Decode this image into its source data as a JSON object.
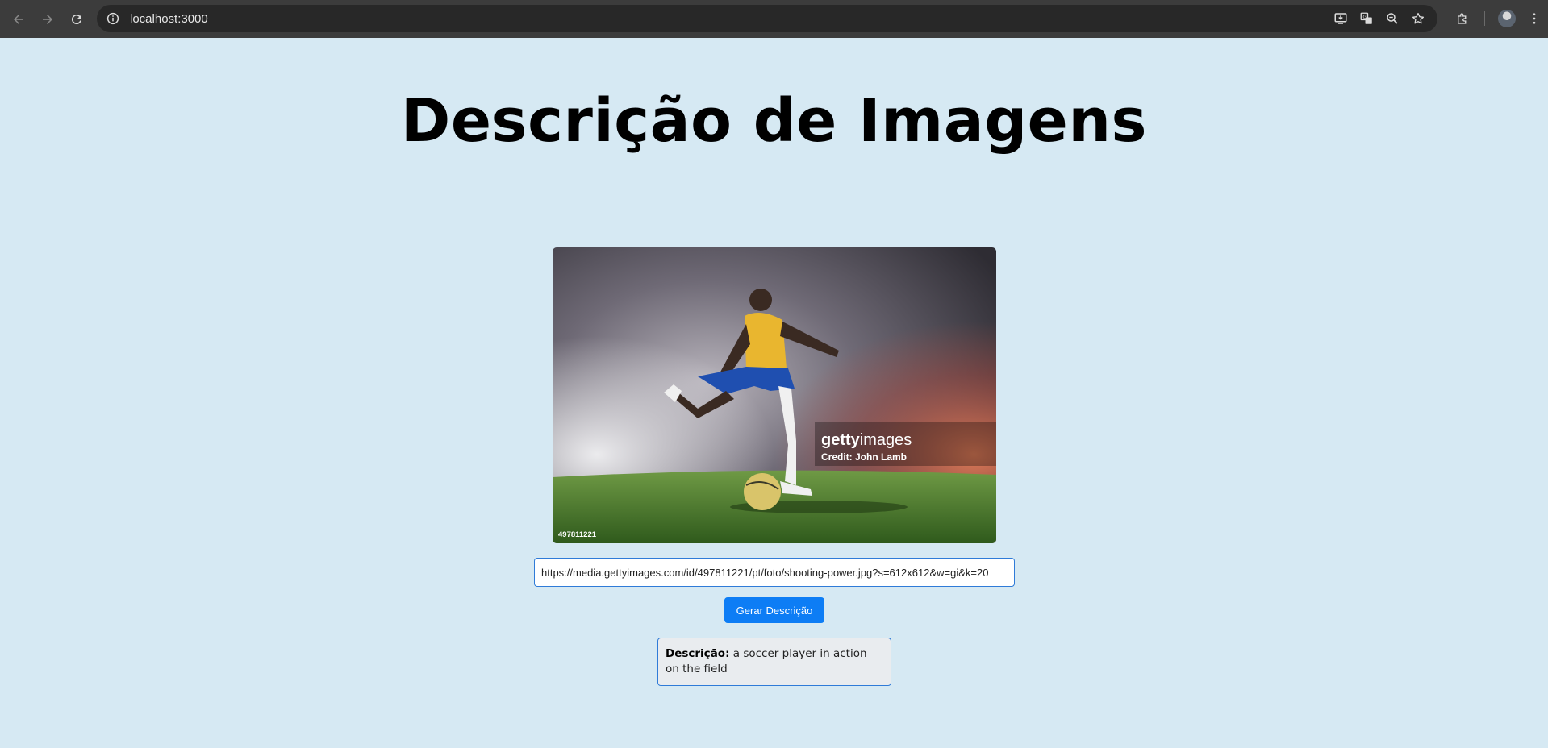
{
  "browser": {
    "url": "localhost:3000",
    "icons": [
      "back-icon",
      "forward-icon",
      "reload-icon",
      "site-info-icon",
      "install-app-icon",
      "translate-icon",
      "zoom-icon",
      "bookmark-star-icon",
      "extensions-icon",
      "profile-avatar",
      "menu-icon"
    ]
  },
  "page": {
    "title": "Descrição de Imagens"
  },
  "image": {
    "watermark_brand_bold": "getty",
    "watermark_brand_light": "images",
    "watermark_credit": "Credit: John Lamb",
    "image_id": "497811221"
  },
  "form": {
    "url_value": "https://media.gettyimages.com/id/497811221/pt/foto/shooting-power.jpg?s=612x612&w=gi&k=20",
    "submit_label": "Gerar Descrição"
  },
  "result": {
    "label": "Descrição:",
    "text": " a soccer player in action on the field"
  }
}
